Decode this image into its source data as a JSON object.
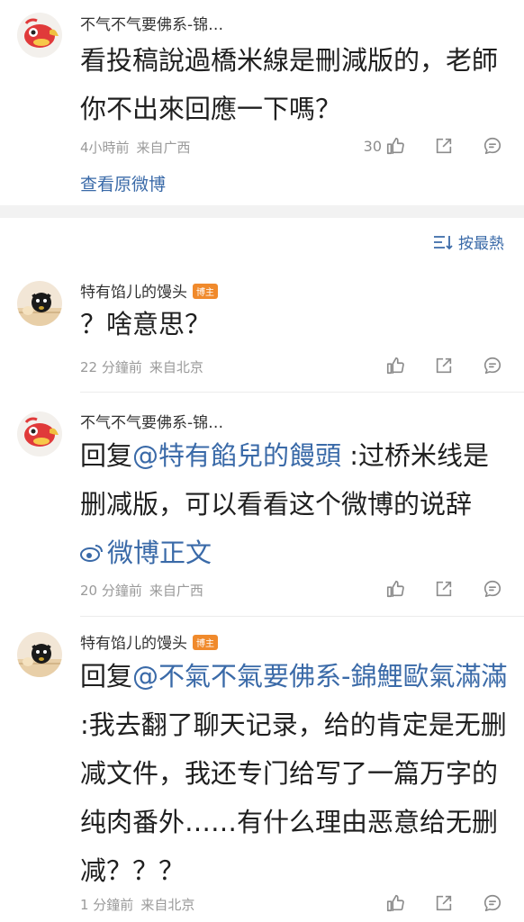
{
  "top_comment": {
    "username": "不气不气要佛系-锦…",
    "text": "看投稿說過橋米線是刪減版的，老師你不出來回應一下嗎？",
    "time": "4小時前",
    "location": "来自广西",
    "likes": "30",
    "view_original": "查看原微博"
  },
  "sort": {
    "label": "按最熱"
  },
  "replies": [
    {
      "username": "特有馅儿的馒头",
      "badge": "博主",
      "text": "？啥意思？",
      "time": "22 分鐘前",
      "location": "来自北京"
    },
    {
      "username": "不气不气要佛系-锦…",
      "reply_prefix": "回复",
      "mention": "@特有餡兒的饅頭",
      "text": " :过桥米线是删减版，可以看看这个微博的说辞",
      "weibo_link": "微博正文",
      "time": "20 分鐘前",
      "location": "来自广西"
    },
    {
      "username": "特有馅儿的馒头",
      "badge": "博主",
      "reply_prefix": "回复",
      "mention": "@不氣不氣要佛系-錦鯉歐氣滿滿",
      "text": " :我去翻了聊天记录，给的肯定是无删减文件，我还专门给写了一篇万字的纯肉番外……有什么理由恶意给无删减？？？",
      "time": "1 分鐘前",
      "location": "来自北京"
    }
  ],
  "colors": {
    "link": "#3a6aa8",
    "badge": "#f08a2c",
    "divider": "#f2f2f2"
  }
}
